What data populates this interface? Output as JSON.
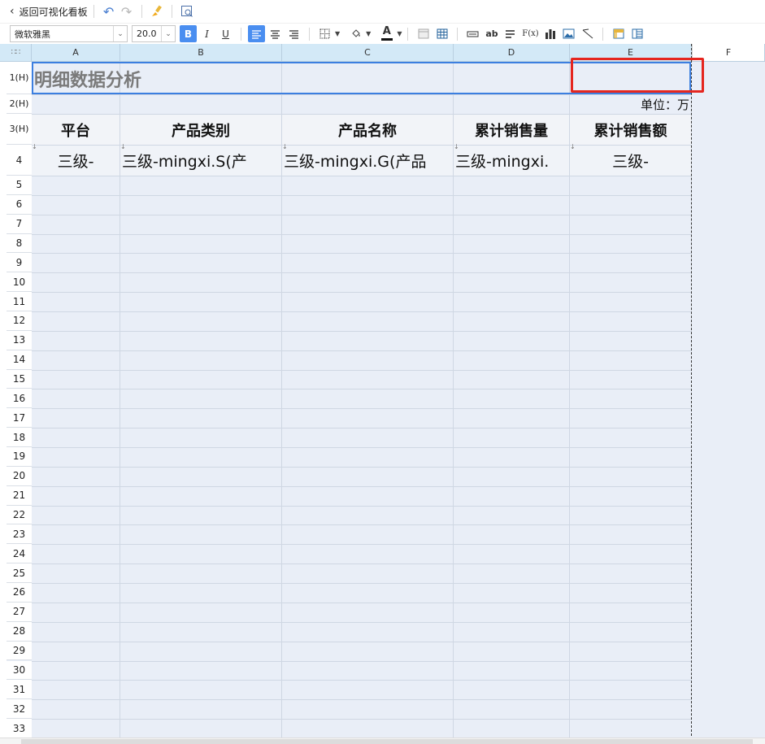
{
  "toolbar": {
    "back_label": "返回可视化看板",
    "font_name": "微软雅黑",
    "font_size": "20.0",
    "bold": "B",
    "italic": "I",
    "underline": "U",
    "text_ab": "ab",
    "formula": "F(x)",
    "font_color_letter": "A"
  },
  "grid": {
    "columns": [
      "A",
      "B",
      "C",
      "D",
      "E",
      "F"
    ],
    "rows": [
      "1(H)",
      "2(H)",
      "3(H)",
      "4",
      "5",
      "6",
      "7",
      "8",
      "9",
      "10",
      "11",
      "12",
      "13",
      "14",
      "15",
      "16",
      "17",
      "18",
      "19",
      "20",
      "21",
      "22",
      "23",
      "24",
      "25",
      "26",
      "27",
      "28",
      "29",
      "30",
      "31",
      "32",
      "33"
    ]
  },
  "cells": {
    "title": "明细数据分析",
    "unit": "单位：万",
    "headers": [
      "平台",
      "产品类别",
      "产品名称",
      "累计销售量",
      "累计销售额"
    ],
    "data_row": [
      "三级-",
      "三级-mingxi.S(产",
      "三级-mingxi.G(产品",
      "三级-mingxi.",
      "三级-"
    ]
  },
  "colors": {
    "selection": "#3c7fe0",
    "highlight_box": "#e5261f",
    "column_header_bg": "#d3e9f7",
    "sheet_bg": "#e9eef7"
  },
  "icons": [
    "chevron-left-icon",
    "undo-icon",
    "redo-icon",
    "brush-icon",
    "preview-icon",
    "align-left-icon",
    "align-center-icon",
    "align-right-icon",
    "border-icon",
    "fill-color-icon",
    "font-color-icon",
    "cell-icon",
    "table-icon",
    "merge-icon",
    "text-icon",
    "paragraph-icon",
    "formula-icon",
    "chart-icon",
    "image-icon",
    "slash-icon",
    "freeze-icon",
    "layout-icon"
  ]
}
